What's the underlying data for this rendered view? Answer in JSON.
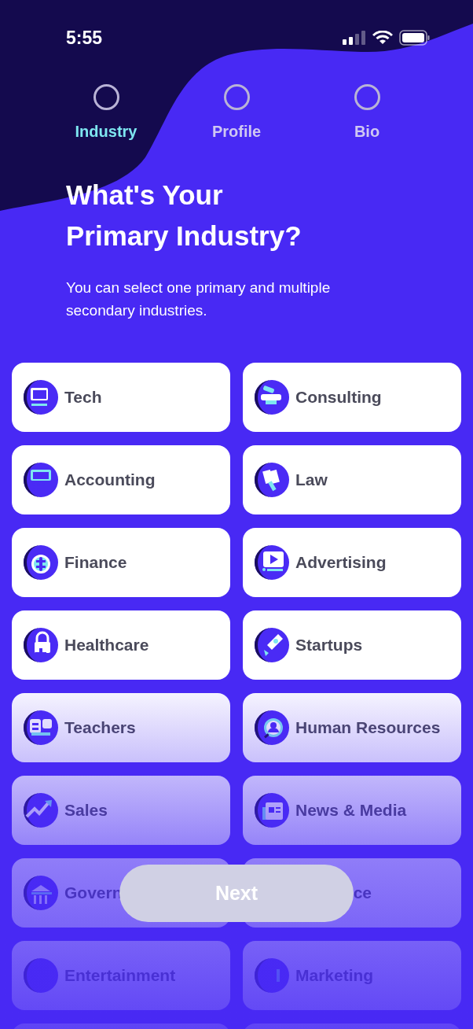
{
  "status_bar": {
    "time": "5:55"
  },
  "steps": [
    {
      "label": "Industry",
      "selected": true
    },
    {
      "label": "Profile",
      "selected": false
    },
    {
      "label": "Bio",
      "selected": false
    }
  ],
  "title_lines": [
    "What's Your",
    "Primary Industry?"
  ],
  "subtitle": "You can select one primary and multiple secondary industries.",
  "industries": [
    {
      "label": "Tech",
      "kind": "tile"
    },
    {
      "label": "Consulting",
      "kind": "tile"
    },
    {
      "label": "Accounting",
      "kind": "tile"
    },
    {
      "label": "Law",
      "kind": "tile"
    },
    {
      "label": "Finance",
      "kind": "tile"
    },
    {
      "label": "Advertising",
      "kind": "tile"
    },
    {
      "label": "Healthcare",
      "kind": "tile"
    },
    {
      "label": "Startups",
      "kind": "tile"
    },
    {
      "label": "Teachers",
      "kind": "tile"
    },
    {
      "label": "Human Resources",
      "kind": "tile"
    },
    {
      "label": "Sales",
      "kind": "tile"
    },
    {
      "label": "News & Media",
      "kind": "tile"
    },
    {
      "label": "Govern",
      "kind": "tile"
    },
    {
      "label": "ce",
      "kind": "covered"
    },
    {
      "label": "Entertainment",
      "kind": "tile"
    },
    {
      "label": "Marketing",
      "kind": "tile"
    },
    {
      "kind": "cut"
    },
    {
      "kind": "cut"
    }
  ],
  "next_button": {
    "label": "Next",
    "disabled": true
  }
}
